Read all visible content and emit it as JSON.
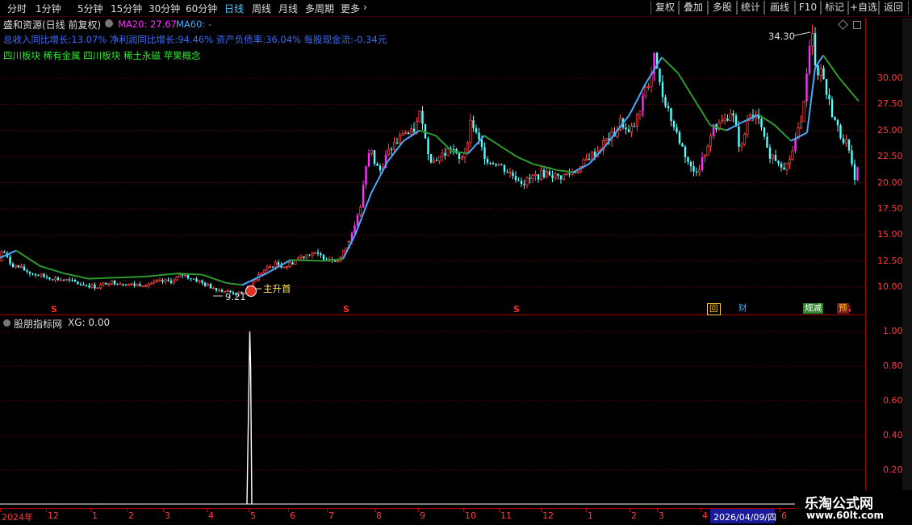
{
  "toolbar": {
    "periods": [
      "分时",
      "1分钟",
      "5分钟",
      "15分钟",
      "30分钟",
      "60分钟",
      "日线",
      "周线",
      "月线",
      "多周期",
      "更多"
    ],
    "active_period": "日线",
    "right_buttons": [
      "复权",
      "叠加",
      "多股",
      "统计",
      "画线",
      "F10",
      "标记",
      "+自选",
      "返回"
    ]
  },
  "header": {
    "title": "盛和资源(日线 前复权)",
    "ma20": "MA20: 27.67",
    "ma60": "MA60: -",
    "fundamentals": "总收入同比增长:13.07% 净利润同比增长:94.46% 资产负债率:36.04% 每股现金流:-0.34元",
    "concepts": "四川板块 稀有金属 四川板块 稀土永磁 苹果概念"
  },
  "annotations": {
    "high_label": "34.30",
    "low_label": "9.21",
    "signal_label": "主升首",
    "signal_marker": "S"
  },
  "badges": [
    "回",
    "财",
    "规减",
    "预"
  ],
  "main_axis_ticks": [
    "30.00",
    "27.50",
    "25.00",
    "22.50",
    "20.00",
    "17.50",
    "15.00",
    "12.50",
    "10.00"
  ],
  "sub_indicator": {
    "title": "股朋指标网",
    "xg": "XG: 0.00",
    "ticks": [
      "1.00",
      "0.80",
      "0.60",
      "0.40",
      "0.20"
    ]
  },
  "date_axis": {
    "labels": [
      "2024年",
      "12",
      "1",
      "2",
      "3",
      "4",
      "5",
      "6",
      "7",
      "8",
      "9",
      "10",
      "11",
      "12",
      "1",
      "2",
      "3",
      "4",
      "6"
    ],
    "cursor_date": "2026/04/09/四"
  },
  "watermark": {
    "name": "乐淘公式网",
    "url": "www.60lt.com"
  },
  "colors": {
    "up": "#ff4040",
    "up_hollow": "#ff3030",
    "down": "#54ffff",
    "ma20": "#2e9a2e",
    "ma_blue": "#4aa8ff",
    "magenta": "#ff30ff",
    "axis": "#b00000"
  },
  "chart_data": {
    "type": "candlestick",
    "ylim": [
      9,
      35
    ],
    "ma20_label": "MA20: 27.67",
    "high": 34.3,
    "low": 9.21,
    "price_path": [
      [
        0,
        12.5
      ],
      [
        3,
        13.8
      ],
      [
        8,
        12.8
      ],
      [
        14,
        12.2
      ],
      [
        25,
        11.8
      ],
      [
        40,
        11.3
      ],
      [
        55,
        11.0
      ],
      [
        70,
        10.8
      ],
      [
        85,
        10.6
      ],
      [
        100,
        10.3
      ],
      [
        120,
        10.0
      ],
      [
        135,
        10.5
      ],
      [
        150,
        10.4
      ],
      [
        165,
        10.2
      ],
      [
        180,
        10.3
      ],
      [
        200,
        10.5
      ],
      [
        215,
        10.6
      ],
      [
        225,
        11.2
      ],
      [
        240,
        10.8
      ],
      [
        255,
        10.2
      ],
      [
        270,
        9.8
      ],
      [
        285,
        9.5
      ],
      [
        300,
        9.3
      ],
      [
        310,
        10.2
      ],
      [
        325,
        11.5
      ],
      [
        340,
        12.2
      ],
      [
        355,
        12.0
      ],
      [
        370,
        12.8
      ],
      [
        385,
        13.3
      ],
      [
        395,
        13.0
      ],
      [
        405,
        12.8
      ],
      [
        420,
        12.6
      ],
      [
        425,
        13.2
      ],
      [
        432,
        14.5
      ],
      [
        440,
        16.0
      ],
      [
        446,
        17.5
      ],
      [
        452,
        21.0
      ],
      [
        458,
        23.5
      ],
      [
        464,
        22.0
      ],
      [
        470,
        21.0
      ],
      [
        478,
        22.5
      ],
      [
        486,
        23.5
      ],
      [
        494,
        24.0
      ],
      [
        500,
        25.0
      ],
      [
        508,
        24.5
      ],
      [
        516,
        25.5
      ],
      [
        522,
        27.0
      ],
      [
        528,
        23.5
      ],
      [
        536,
        22.0
      ],
      [
        544,
        22.5
      ],
      [
        552,
        22.8
      ],
      [
        560,
        23.5
      ],
      [
        568,
        22.0
      ],
      [
        576,
        23.0
      ],
      [
        584,
        26.0
      ],
      [
        590,
        24.5
      ],
      [
        598,
        23.0
      ],
      [
        606,
        22.0
      ],
      [
        614,
        22.0
      ],
      [
        622,
        21.5
      ],
      [
        630,
        21.0
      ],
      [
        640,
        20.5
      ],
      [
        650,
        20.0
      ],
      [
        660,
        20.5
      ],
      [
        670,
        20.8
      ],
      [
        680,
        21.0
      ],
      [
        690,
        20.5
      ],
      [
        700,
        20.7
      ],
      [
        710,
        21.0
      ],
      [
        720,
        21.5
      ],
      [
        730,
        22.5
      ],
      [
        740,
        23.0
      ],
      [
        750,
        24.0
      ],
      [
        760,
        24.5
      ],
      [
        770,
        26.0
      ],
      [
        778,
        24.5
      ],
      [
        786,
        25.5
      ],
      [
        794,
        27.0
      ],
      [
        800,
        29.0
      ],
      [
        806,
        30.0
      ],
      [
        812,
        32.5
      ],
      [
        818,
        29.0
      ],
      [
        826,
        27.5
      ],
      [
        834,
        25.5
      ],
      [
        842,
        24.0
      ],
      [
        850,
        22.5
      ],
      [
        858,
        21.0
      ],
      [
        866,
        21.5
      ],
      [
        874,
        23.0
      ],
      [
        882,
        25.0
      ],
      [
        890,
        25.5
      ],
      [
        898,
        26.0
      ],
      [
        906,
        27.0
      ],
      [
        912,
        25.0
      ],
      [
        918,
        23.0
      ],
      [
        926,
        26.0
      ],
      [
        934,
        26.5
      ],
      [
        942,
        25.5
      ],
      [
        950,
        23.0
      ],
      [
        958,
        22.5
      ],
      [
        966,
        22.0
      ],
      [
        974,
        21.5
      ],
      [
        982,
        23.0
      ],
      [
        990,
        25.5
      ],
      [
        996,
        27.5
      ],
      [
        1002,
        32.0
      ],
      [
        1006,
        34.3
      ],
      [
        1012,
        30.5
      ],
      [
        1018,
        31.0
      ],
      [
        1024,
        28.5
      ],
      [
        1030,
        27.0
      ],
      [
        1036,
        25.5
      ],
      [
        1042,
        24.5
      ],
      [
        1048,
        24.0
      ],
      [
        1054,
        22.0
      ],
      [
        1058,
        20.5
      ],
      [
        1064,
        21.5
      ]
    ],
    "ma_path": [
      [
        0,
        12.8
      ],
      [
        20,
        13.5
      ],
      [
        50,
        12.0
      ],
      [
        80,
        11.3
      ],
      [
        110,
        10.8
      ],
      [
        140,
        10.9
      ],
      [
        180,
        11.0
      ],
      [
        220,
        11.3
      ],
      [
        250,
        11.2
      ],
      [
        280,
        10.4
      ],
      [
        300,
        10.2
      ],
      [
        330,
        11.3
      ],
      [
        360,
        12.6
      ],
      [
        400,
        12.5
      ],
      [
        425,
        12.7
      ],
      [
        440,
        15.0
      ],
      [
        460,
        19.0
      ],
      [
        480,
        22.0
      ],
      [
        500,
        24.0
      ],
      [
        520,
        25.0
      ],
      [
        540,
        24.5
      ],
      [
        560,
        23.0
      ],
      [
        580,
        22.8
      ],
      [
        600,
        24.5
      ],
      [
        620,
        23.5
      ],
      [
        640,
        22.5
      ],
      [
        660,
        21.8
      ],
      [
        690,
        21.2
      ],
      [
        710,
        21.0
      ],
      [
        730,
        21.8
      ],
      [
        750,
        23.5
      ],
      [
        780,
        26.5
      ],
      [
        800,
        29.5
      ],
      [
        820,
        32.0
      ],
      [
        840,
        30.5
      ],
      [
        860,
        28.0
      ],
      [
        880,
        25.5
      ],
      [
        900,
        25.0
      ],
      [
        920,
        25.8
      ],
      [
        940,
        26.5
      ],
      [
        960,
        25.5
      ],
      [
        980,
        24.0
      ],
      [
        1000,
        24.8
      ],
      [
        1010,
        31.0
      ],
      [
        1020,
        32.2
      ],
      [
        1040,
        30.0
      ],
      [
        1064,
        27.8
      ]
    ],
    "sub_series": {
      "type": "line",
      "ylim": [
        0,
        1.0
      ],
      "spike_value": 1.0,
      "spike_date_label": "5"
    }
  }
}
